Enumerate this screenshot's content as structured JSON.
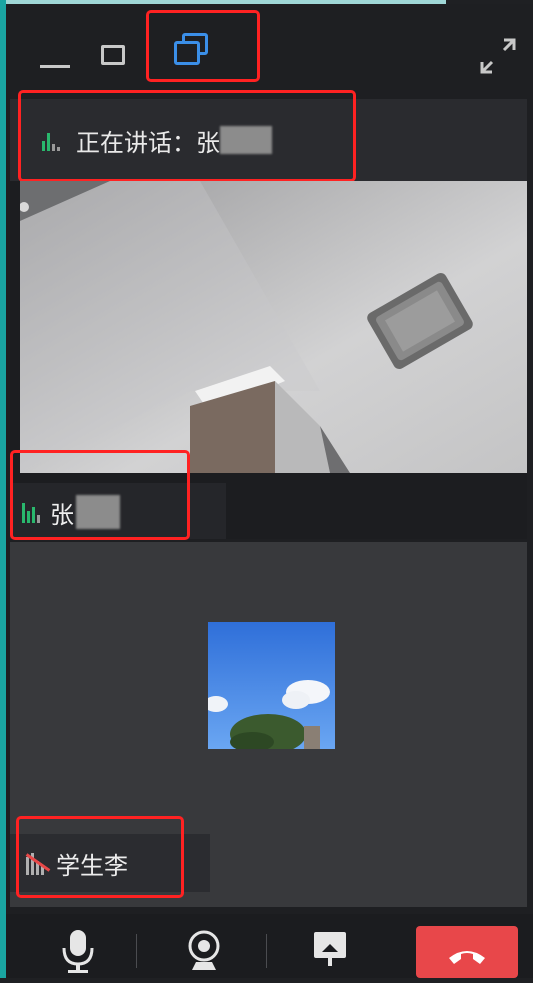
{
  "window": {
    "titlebar": {
      "minimize_icon": "minimize-icon",
      "maximize_icon": "maximize-icon",
      "restore_icon": "restore-icon",
      "expand_icon": "expand-icon",
      "restore_color": "#3b8fe8"
    }
  },
  "speaker": {
    "label": "正在讲话：张",
    "icon": "audio-level-icon",
    "level_color": "#29b86d"
  },
  "participants": [
    {
      "name": "张",
      "icon": "audio-level-icon",
      "video": "camera-feed"
    },
    {
      "name": "学生李",
      "icon": "mic-muted-icon",
      "video": "avatar-image"
    }
  ],
  "controls": {
    "mic_icon": "microphone-icon",
    "camera_icon": "webcam-icon",
    "share_icon": "screen-share-icon",
    "hangup_icon": "hang-up-icon",
    "hangup_color": "#e8474a"
  },
  "annotation_color": "#ff2222"
}
